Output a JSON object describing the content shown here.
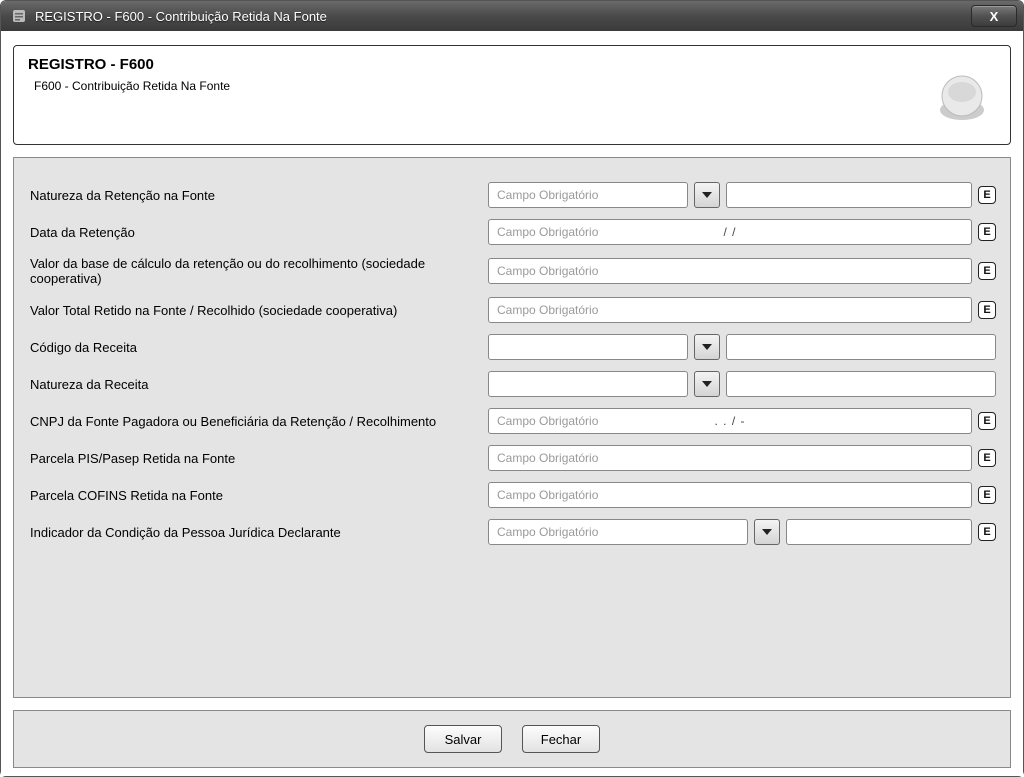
{
  "window": {
    "title": "REGISTRO - F600 - Contribuição Retida Na Fonte"
  },
  "header": {
    "title": "REGISTRO - F600",
    "subtitle": "F600 - Contribuição Retida Na Fonte"
  },
  "placeholders": {
    "required": "Campo Obrigatório"
  },
  "masks": {
    "date": "/ /",
    "cnpj": ". .  /  -"
  },
  "labels": {
    "natureza_retencao": "Natureza da Retenção na Fonte",
    "data_retencao": "Data da Retenção",
    "valor_base": "Valor da base de cálculo da retenção ou do recolhimento (sociedade cooperativa)",
    "valor_total": "Valor Total Retido na Fonte / Recolhido (sociedade cooperativa)",
    "codigo_receita": "Código da Receita",
    "natureza_receita": "Natureza da Receita",
    "cnpj_fonte": "CNPJ da Fonte Pagadora ou Beneficiária da Retenção / Recolhimento",
    "parcela_pis": "Parcela PIS/Pasep Retida na Fonte",
    "parcela_cofins": "Parcela COFINS Retida na Fonte",
    "indicador_condicao": "Indicador da Condição da Pessoa Jurídica Declarante"
  },
  "buttons": {
    "save": "Salvar",
    "close": "Fechar",
    "close_x": "X",
    "error_badge": "E"
  }
}
